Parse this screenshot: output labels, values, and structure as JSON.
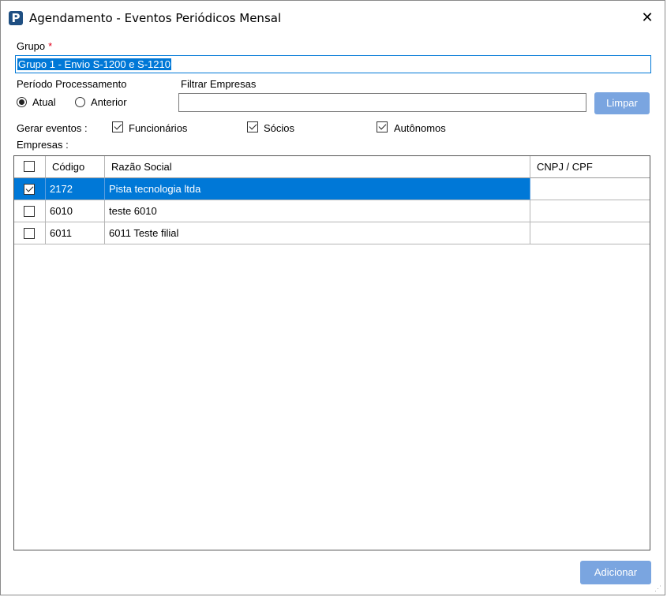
{
  "window": {
    "app_icon_glyph": "P",
    "title": "Agendamento - Eventos Periódicos Mensal",
    "close_glyph": "✕"
  },
  "grupo": {
    "label": "Grupo",
    "required_mark": "*",
    "value": "Grupo 1 - Envio S-1200 e S-1210"
  },
  "periodo": {
    "label": "Período Processamento",
    "options": [
      {
        "label": "Atual",
        "selected": true
      },
      {
        "label": "Anterior",
        "selected": false
      }
    ]
  },
  "filtro": {
    "label": "Filtrar Empresas",
    "value": "",
    "clear_button": "Limpar"
  },
  "gerar": {
    "label": "Gerar eventos :",
    "options": [
      {
        "label": "Funcionários",
        "checked": true
      },
      {
        "label": "Sócios",
        "checked": true
      },
      {
        "label": "Autônomos",
        "checked": true
      }
    ]
  },
  "empresas": {
    "label": "Empresas :",
    "columns": [
      "Código",
      "Razão Social",
      "CNPJ / CPF"
    ],
    "header_checked": false,
    "rows": [
      {
        "checked": true,
        "codigo": "2172",
        "razao": "Pista tecnologia  ltda",
        "cnpj": "",
        "selected": true
      },
      {
        "checked": false,
        "codigo": "6010",
        "razao": "teste 6010",
        "cnpj": "",
        "selected": false
      },
      {
        "checked": false,
        "codigo": "6011",
        "razao": "6011 Teste filial",
        "cnpj": "",
        "selected": false
      }
    ]
  },
  "footer": {
    "add_button": "Adicionar"
  },
  "colors": {
    "selection": "#0078d7",
    "button": "#7aa5e0",
    "required": "#e0001b",
    "app_icon": "#1f4f82"
  }
}
